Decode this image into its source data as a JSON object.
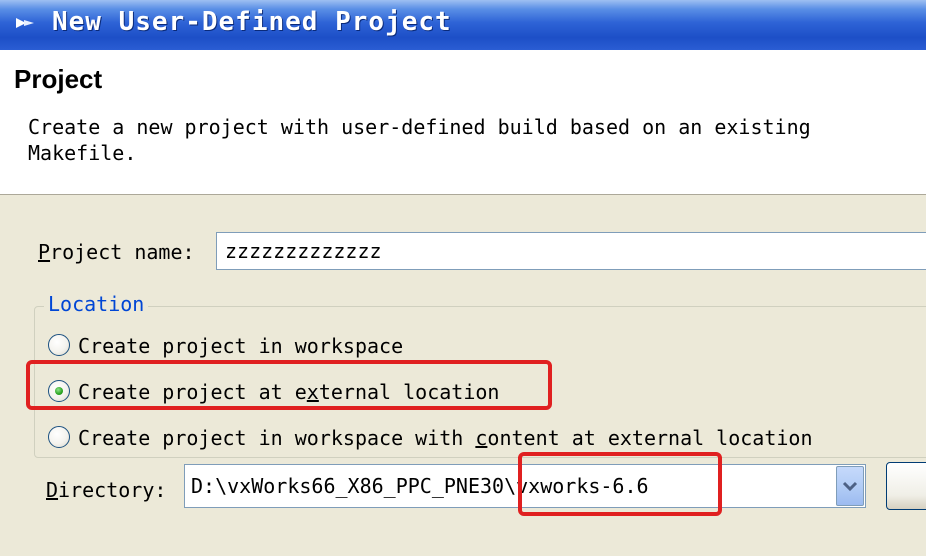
{
  "dialog": {
    "title": "New User-Defined Project"
  },
  "header": {
    "title": "Project",
    "description": "Create a new project with user-defined build based on an existing\nMakefile."
  },
  "form": {
    "project_name_label_mnemonic": "P",
    "project_name_label_rest": "roject name:",
    "project_name_value": "zzzzzzzzzzzzz",
    "location_group_label": "Location",
    "radio_workspace_label": "Create project in workspace",
    "radio_external_label_pre": "Create project at e",
    "radio_external_label_mnemonic": "x",
    "radio_external_label_post": "ternal location",
    "radio_content_label_pre": "Create project in workspace with ",
    "radio_content_label_mnemonic": "c",
    "radio_content_label_post": "ontent at external location",
    "selected_location": "Create project at external location",
    "directory_label_mnemonic": "D",
    "directory_label_rest": "irectory:",
    "directory_value": "D:\\vxWorks66_X86_PPC_PNE30\\vxworks-6.6"
  },
  "colors": {
    "title_bar": "#1d4fc7",
    "group_label": "#0046d5",
    "highlight": "#e02020",
    "radio_selected_dot": "#2aa521",
    "dialog_background": "#ece9d8"
  },
  "icons": {
    "title_icon": "wizard-arrow-icon",
    "combo_dropdown": "chevron-down-icon"
  }
}
